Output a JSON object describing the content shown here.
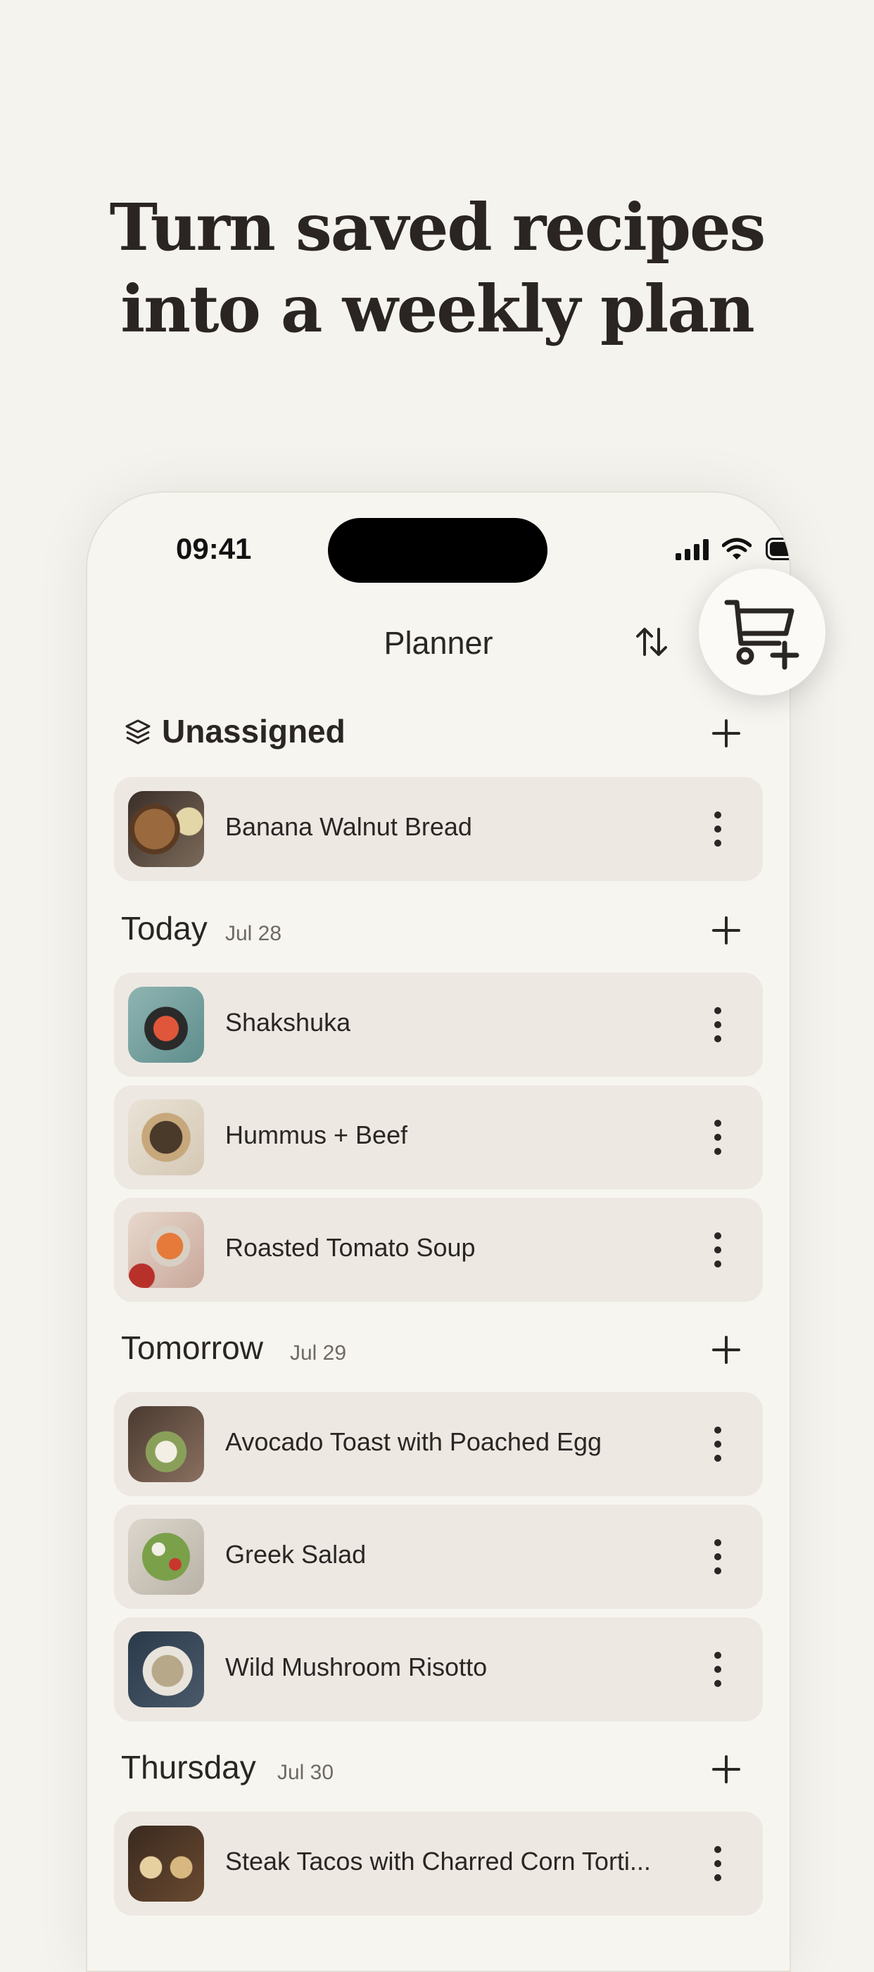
{
  "headline": {
    "line1": "Turn saved recipes",
    "line2": "into a weekly plan"
  },
  "status_bar": {
    "time": "09:41"
  },
  "nav": {
    "title": "Planner",
    "sort_icon": "sort-arrows-icon",
    "cart_icon": "cart-add-icon"
  },
  "sections": [
    {
      "title": "Unassigned",
      "date": "",
      "icon": "layers-icon",
      "items": [
        {
          "name": "Banana Walnut Bread"
        }
      ]
    },
    {
      "title": "Today",
      "date": "Jul 28",
      "items": [
        {
          "name": "Shakshuka"
        },
        {
          "name": "Hummus + Beef"
        },
        {
          "name": "Roasted Tomato Soup"
        }
      ]
    },
    {
      "title": "Tomorrow",
      "date": "Jul 29",
      "items": [
        {
          "name": "Avocado Toast with Poached Egg"
        },
        {
          "name": "Greek Salad"
        },
        {
          "name": "Wild Mushroom Risotto"
        }
      ]
    },
    {
      "title": "Thursday",
      "date": "Jul 30",
      "items": [
        {
          "name": "Steak Tacos with Charred Corn Torti..."
        }
      ]
    }
  ],
  "colors": {
    "background": "#f5f3ee",
    "card": "#ede8e2",
    "text": "#2a2624"
  }
}
